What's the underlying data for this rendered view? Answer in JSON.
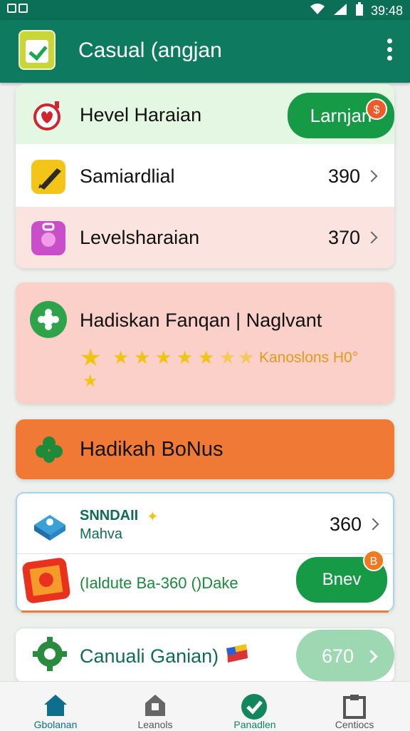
{
  "status_bar": {
    "time": "39:48"
  },
  "app_bar": {
    "title": "Casual (angjan",
    "app_icon": "calendar-check-icon",
    "menu_icon": "more-vert-icon"
  },
  "card1": {
    "header": {
      "label": "Hevel Haraian",
      "button": "Larnjan",
      "badge": "$",
      "icon": "heart-stopwatch-icon"
    },
    "rows": [
      {
        "label": "Samiardlial",
        "value": "390",
        "icon": "pencil-icon"
      },
      {
        "label": "Levelsharaian",
        "value": "370",
        "icon": "bag-icon"
      }
    ]
  },
  "card2": {
    "title": "Hadiskan Fanqan | Naglvant",
    "icon": "flower-icon",
    "stars_text": "Kanoslons H0°",
    "star_icon": "star-icon"
  },
  "bonus_banner": {
    "label": "Hadikah BoNus",
    "icon": "clover-icon"
  },
  "card3": {
    "row1": {
      "line1": "SNNDAII",
      "line2": "Mahva",
      "value": "360",
      "icon": "cube-icon"
    },
    "row2": {
      "label": "(Ialdute Ba-360 ()Dake",
      "button": "Bnev",
      "badge": "B",
      "icon": "gift-box-icon"
    }
  },
  "card4": {
    "label": "Canuali Ganian)",
    "value": "670",
    "icon": "gear-icon"
  },
  "bottom_nav": [
    {
      "label": "Gbolanan",
      "icon": "home-icon"
    },
    {
      "label": "Leanols",
      "icon": "house-lock-icon"
    },
    {
      "label": "Panadlen",
      "icon": "check-circle-icon"
    },
    {
      "label": "Centiocs",
      "icon": "clipboard-icon"
    }
  ],
  "colors": {
    "primary": "#0e7a5f",
    "accent_green": "#179a46",
    "orange": "#f07a35",
    "pink_card": "#fad0c8"
  }
}
